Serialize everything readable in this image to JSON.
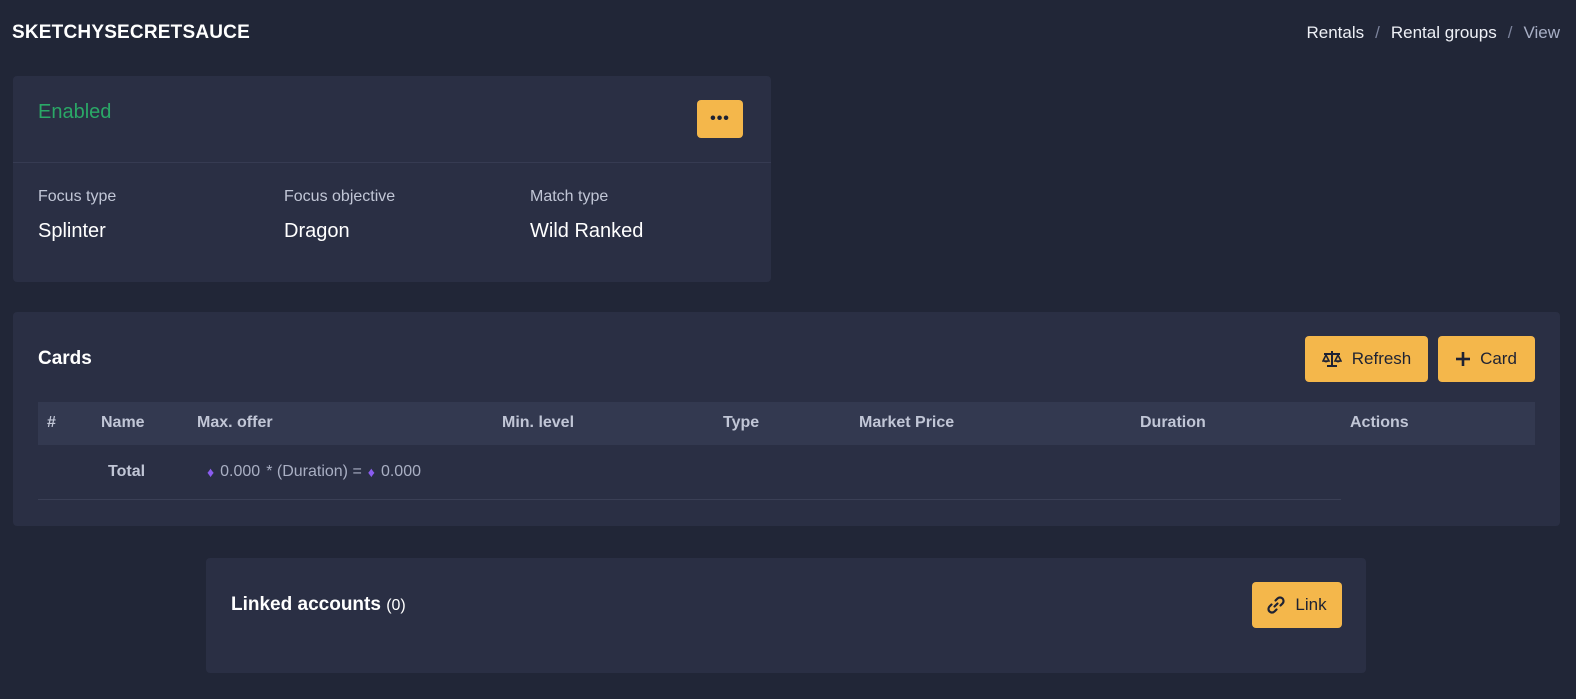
{
  "header": {
    "app_title": "SKETCHYSECRETSAUCE",
    "breadcrumb": [
      "Rentals",
      "Rental groups",
      "View"
    ],
    "separator": "/"
  },
  "status_card": {
    "status": "Enabled",
    "status_color": "#2aa867",
    "more_label": "•••",
    "fields": [
      {
        "label": "Focus type",
        "value": "Splinter"
      },
      {
        "label": "Focus objective",
        "value": "Dragon"
      },
      {
        "label": "Match type",
        "value": "Wild Ranked"
      }
    ]
  },
  "cards_section": {
    "title": "Cards",
    "refresh_label": "Refresh",
    "add_label": "Card",
    "columns": [
      "#",
      "Name",
      "Max. offer",
      "Min. level",
      "Type",
      "Market Price",
      "Duration",
      "Actions"
    ],
    "total": {
      "label": "Total",
      "amount": "0.000",
      "formula_middle": "* (Duration) =",
      "result": "0.000"
    }
  },
  "linked_accounts": {
    "title": "Linked accounts",
    "count": "(0)",
    "link_label": "Link"
  },
  "colors": {
    "accent": "#f4b74b",
    "background": "#212637",
    "panel": "#2a2f44",
    "currency": "#8a5cf0"
  }
}
